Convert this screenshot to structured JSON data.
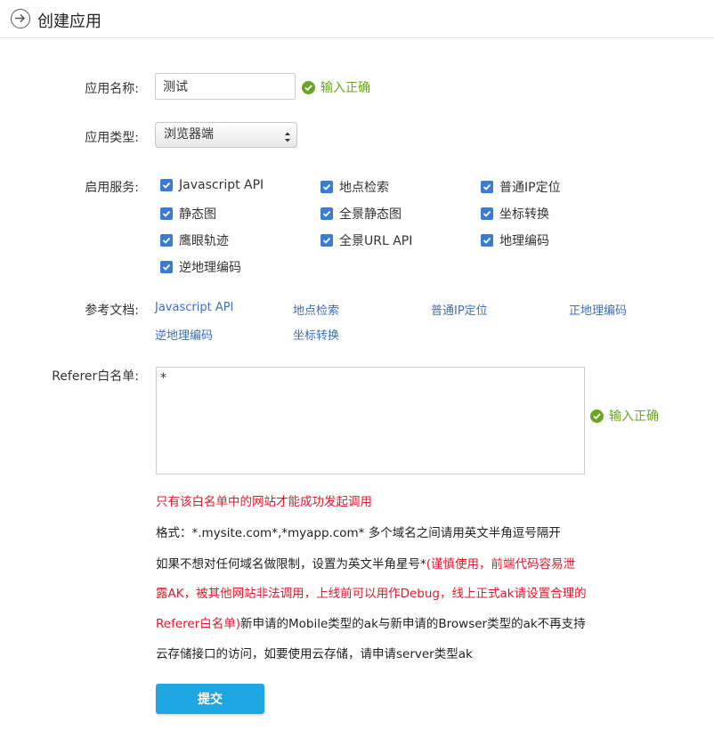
{
  "header": {
    "title": "创建应用"
  },
  "form": {
    "name_label": "应用名称:",
    "name_value": "测试",
    "valid_text": "输入正确",
    "type_label": "应用类型:",
    "type_value": "浏览器端",
    "services_label": "启用服务:",
    "services": [
      {
        "label": "Javascript API",
        "checked": true
      },
      {
        "label": "地点检索",
        "checked": true
      },
      {
        "label": "普通IP定位",
        "checked": true
      },
      {
        "label": "静态图",
        "checked": true
      },
      {
        "label": "全景静态图",
        "checked": true
      },
      {
        "label": "坐标转换",
        "checked": true
      },
      {
        "label": "鹰眼轨迹",
        "checked": true
      },
      {
        "label": "全景URL API",
        "checked": true
      },
      {
        "label": "地理编码",
        "checked": true
      },
      {
        "label": "逆地理编码",
        "checked": true
      }
    ],
    "docs_label": "参考文档:",
    "docs": [
      "Javascript API",
      "地点检索",
      "普通IP定位",
      "正地理编码",
      "逆地理编码",
      "坐标转换"
    ],
    "referer_label": "Referer白名单:",
    "referer_value": "*",
    "referer_valid_text": "输入正确",
    "notes": {
      "line1": "只有该白名单中的网站才能成功发起调用",
      "line2": "格式：*.mysite.com*,*myapp.com* 多个域名之间请用英文半角逗号隔开",
      "line3_normal": "如果不想对任何域名做限制，设置为英文半角星号*",
      "line3_red": "(谨慎使用，前端代码容易泄",
      "line4_red": "露AK，被其他网站非法调用，上线前可以用作Debug，线上正式ak请设置合理的",
      "line5_red": "Referer白名单)",
      "line5_normal": "新申请的Mobile类型的ak与新申请的Browser类型的ak不再支持",
      "line6": "云存储接口的访问，如要使用云存储，请申请server类型ak"
    },
    "submit_label": "提交"
  },
  "colors": {
    "valid_green": "#6aa524",
    "checkbox_blue": "#3a7bd5",
    "link_blue": "#3c6fb7",
    "warning_red": "#e0182b",
    "button_blue": "#1ea6e3"
  }
}
